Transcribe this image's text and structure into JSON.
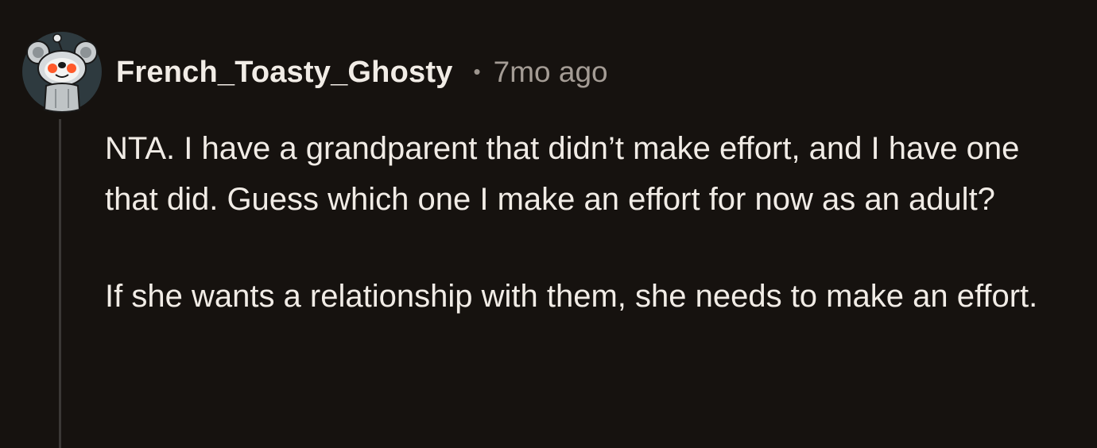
{
  "comment": {
    "author": "French_Toasty_Ghosty",
    "separator": "•",
    "age": "7mo ago",
    "body": [
      "NTA. I have a grandparent that didn’t make effort, and I have one that did. Guess which one I make an effort for now as an adult?",
      "If she wants a relationship with them, she needs to make an effort."
    ]
  },
  "icons": {
    "avatar": "snoo-koala-avatar-icon"
  },
  "colors": {
    "background": "#16120f",
    "text": "#f1ece6",
    "muted": "#a49c95",
    "avatar_bg": "#2e3a3f",
    "thread_line": "#3b3836"
  }
}
